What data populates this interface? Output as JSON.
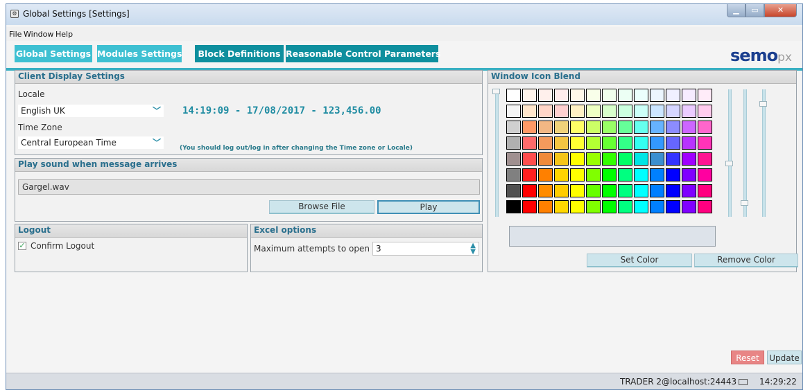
{
  "window": {
    "title": "Global Settings [Settings]"
  },
  "menu": [
    "File",
    "Window",
    "Help"
  ],
  "tabs": [
    "Global Settings",
    "Modules Settings",
    "Block Definitions",
    "Reasonable Control Parameters"
  ],
  "logo": {
    "main": "semo",
    "suffix": "px"
  },
  "client_display": {
    "title": "Client Display Settings",
    "locale_label": "Locale",
    "locale_value": "English UK",
    "clock_preview": "14:19:09 - 17/08/2017 - 123,456.00",
    "timezone_label": "Time Zone",
    "timezone_value": "Central European Time",
    "hint": "(You should log out/log in after changing the Time zone or Locale)"
  },
  "sound": {
    "title": "Play sound when message arrives",
    "file": "Gargel.wav",
    "browse_label": "Browse File",
    "play_label": "Play"
  },
  "logout": {
    "title": "Logout",
    "confirm_label": "Confirm Logout",
    "confirm_checked": true
  },
  "excel": {
    "title": "Excel options",
    "max_attempts_label": "Maximum attempts to open",
    "max_attempts_value": "3"
  },
  "icon_blend": {
    "title": "Window Icon Blend",
    "set_color_label": "Set Color",
    "remove_color_label": "Remove Color",
    "swatches": [
      [
        "#ffffff",
        "#fff5ec",
        "#fff0ec",
        "#ffecec",
        "#fff9ea",
        "#f9ffea",
        "#f0ffec",
        "#ecfff4",
        "#ecfffd",
        "#ecf6ff",
        "#f0f0ff",
        "#f7ecff",
        "#ffecf9"
      ],
      [
        "#f4f4f4",
        "#ffe6cc",
        "#ffd6c8",
        "#ffd0d0",
        "#fff1c4",
        "#eeffc4",
        "#d8ffcc",
        "#ccffe0",
        "#ccfff8",
        "#cce6ff",
        "#d6d6ff",
        "#ebccff",
        "#ffcdef"
      ],
      [
        "#cfcfcf",
        "#ff9966",
        "#f2b784",
        "#f0d27a",
        "#ffff66",
        "#ccff66",
        "#99ff66",
        "#66ff99",
        "#66ffee",
        "#66b3ff",
        "#8c8cff",
        "#cc66ff",
        "#ff66cc"
      ],
      [
        "#b0b0b0",
        "#ff6a6a",
        "#f49a5c",
        "#f4c542",
        "#ffff33",
        "#b3ff33",
        "#66ff33",
        "#33ff88",
        "#33fff0",
        "#3399ff",
        "#6666ff",
        "#b833ff",
        "#ff33b8"
      ],
      [
        "#a09090",
        "#ff4d4d",
        "#f08a3a",
        "#f5c518",
        "#ffff00",
        "#99ff00",
        "#33ff00",
        "#00ff66",
        "#00e5e5",
        "#3a8fd0",
        "#3333ff",
        "#a000ff",
        "#ff1493"
      ],
      [
        "#808080",
        "#ff2020",
        "#ff8000",
        "#ffd400",
        "#ffff00",
        "#80ff00",
        "#00ff00",
        "#00ff80",
        "#00ffff",
        "#0080ff",
        "#0000ff",
        "#8000ff",
        "#ff00a0"
      ],
      [
        "#505050",
        "#ff0000",
        "#ff8c00",
        "#ffcc00",
        "#ffff00",
        "#66ff00",
        "#00ff00",
        "#00ff80",
        "#00ffff",
        "#007fff",
        "#0000ff",
        "#7f00ff",
        "#ff0080"
      ],
      [
        "#000000",
        "#ff0000",
        "#ff8000",
        "#ffd700",
        "#ffff00",
        "#80ff00",
        "#00ff00",
        "#00ff80",
        "#00ffff",
        "#0080ff",
        "#0000ff",
        "#8000ff",
        "#ff0080"
      ]
    ]
  },
  "actions": {
    "reset_label": "Reset",
    "update_label": "Update"
  },
  "status": {
    "connection": "TRADER 2@localhost:24443",
    "time": "14:29:22"
  }
}
